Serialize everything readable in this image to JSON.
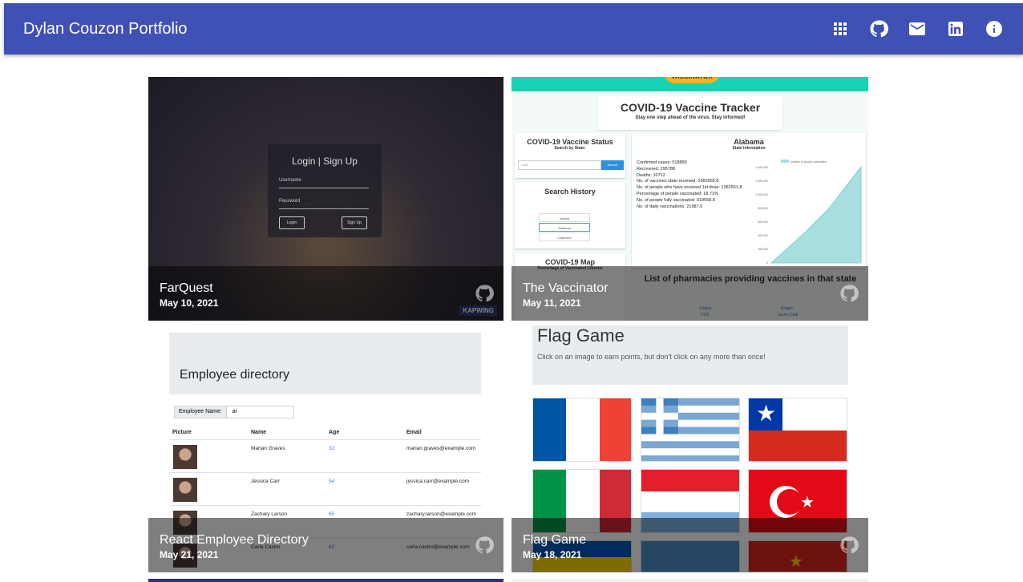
{
  "app": {
    "title": "Dylan Couzon Portfolio",
    "header_color": "#3f51b5",
    "header_icons": [
      "apps-icon",
      "github-icon",
      "mail-icon",
      "linkedin-icon",
      "info-icon"
    ]
  },
  "projects": [
    {
      "title": "FarQuest",
      "date": "May 10, 2021",
      "icon": "github-icon",
      "screenshot": {
        "login_heading": "Login | Sign Up",
        "username_label": "Username",
        "password_label": "Password",
        "login_button": "Login",
        "signup_button": "Sign Up",
        "watermark": "KAPWING"
      }
    },
    {
      "title": "The Vaccinator",
      "date": "May 11, 2021",
      "icon": "github-icon",
      "screenshot": {
        "logo": "VACCINATOR",
        "heading": "COVID-19 Vaccine Tracker",
        "subheading": "Stay one step ahead of the virus. Stay informed!",
        "status_title": "COVID-19 Vaccine Status",
        "status_sub": "Search by State:",
        "search_placeholder": "State",
        "search_button": "Search",
        "history_title": "Search History",
        "history_items": [
          "Alaska",
          "Alabama",
          "California"
        ],
        "map_title": "COVID-19 Map",
        "map_sub": "Percentage of Vaccinated Citizens",
        "state_title": "Alabama",
        "state_sub": "State Information",
        "stats": [
          "Confirmed cases: 518899",
          "Recovered: 295788",
          "Deaths: 10712",
          "No. of vaccines state received: 2982665.8",
          "No. of people who have received 1st dose: 1382551.8",
          "Percentage of people vaccinated: 18.71%",
          "No. of people fully vaccinated: 919558.8",
          "No. of daily vaccinations: 21987.0"
        ],
        "chart_legend": "number of people vaccinated",
        "chart_y_ticks": [
          "1,400,000",
          "1,200,000",
          "1,000,000",
          "800,000",
          "600,000",
          "400,000",
          "200,000",
          "0"
        ],
        "pharmacies_title": "List of pharmacies providing vaccines in that state",
        "pharmacies": [
          "Costco",
          "Kroger",
          "CVS",
          "Sam's Club"
        ]
      }
    },
    {
      "title": "React Employee Directory",
      "date": "May 21, 2021",
      "icon": "github-icon",
      "screenshot": {
        "heading": "Employee directory",
        "search_label": "Employee Name:",
        "search_value": "ar",
        "columns": [
          "Picture",
          "Name",
          "Age",
          "Email"
        ],
        "rows": [
          {
            "name": "Marian Graves",
            "age": "32",
            "email": "marian.graves@example.com"
          },
          {
            "name": "Jessica Carr",
            "age": "54",
            "email": "jessica.carr@example.com"
          },
          {
            "name": "Zachary Larson",
            "age": "65",
            "email": "zachary.larson@example.com"
          },
          {
            "name": "Carla Castro",
            "age": "62",
            "email": "carla.castro@example.com"
          }
        ]
      }
    },
    {
      "title": "Flag Game",
      "date": "May 18, 2021",
      "icon": "github-icon",
      "screenshot": {
        "heading": "Flag Game",
        "instructions": "Click on an image to earn points, but don't click on any more than once!",
        "flags": [
          "France",
          "Greece",
          "Chile",
          "Italy",
          "Netherlands",
          "Turkey",
          "Ukraine",
          "Argentina",
          "Vietnam"
        ]
      }
    }
  ]
}
